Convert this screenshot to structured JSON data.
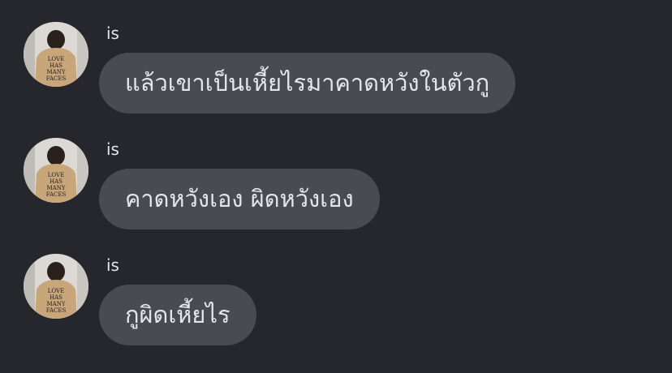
{
  "messages": [
    {
      "sender": "is",
      "text": "แล้วเขาเป็นเหี้ยไรมาคาดหวังในตัวกู",
      "avatar_shirt_text": "LOVE HAS MANY FACES"
    },
    {
      "sender": "is",
      "text": "คาดหวังเอง ผิดหวังเอง",
      "avatar_shirt_text": "LOVE HAS MANY FACES"
    },
    {
      "sender": "is",
      "text": "กูผิดเหี้ยไร",
      "avatar_shirt_text": "LOVE HAS MANY FACES"
    }
  ],
  "colors": {
    "background": "#26272c",
    "bubble": "#4a4b50",
    "text": "#e4e6eb"
  },
  "icons": {
    "avatar": "profile-photo"
  }
}
